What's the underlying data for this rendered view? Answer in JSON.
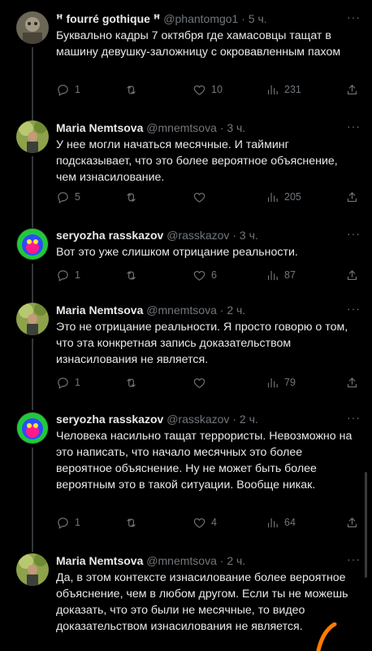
{
  "tweets": [
    {
      "name": "ꟸ fourré gothique ꟸ",
      "handle": "@phantomgo1",
      "time": "5 ч.",
      "text": "Буквально кадры 7 октября где хамасовцы тащат в машину девушку-заложницу с окровавленным пахом",
      "replies": "1",
      "retweets": "",
      "likes": "10",
      "views": "231"
    },
    {
      "name": "Maria Nemtsova",
      "handle": "@mnemtsova",
      "time": "3 ч.",
      "text": "У нее могли начаться месячные. И тайминг подсказывает, что это более вероятное объяснение, чем изнасилование.",
      "replies": "5",
      "retweets": "",
      "likes": "",
      "views": "205"
    },
    {
      "name": "seryozha rasskazov",
      "handle": "@rasskazov",
      "time": "3 ч.",
      "text": "Вот это уже слишком отрицание реальности.",
      "replies": "1",
      "retweets": "",
      "likes": "6",
      "views": "87"
    },
    {
      "name": "Maria Nemtsova",
      "handle": "@mnemtsova",
      "time": "2 ч.",
      "text": "Это не отрицание реальности. Я просто говорю о том, что эта конкретная запись доказательством изнасилования не является.",
      "replies": "1",
      "retweets": "",
      "likes": "",
      "views": "79"
    },
    {
      "name": "seryozha rasskazov",
      "handle": "@rasskazov",
      "time": "2 ч.",
      "text": "Человека насильно тащат террористы. Невозможно на это написать, что начало месячных это более вероятное объяснение. Ну не может быть более вероятным это в такой ситуации. Вообще никак.",
      "replies": "1",
      "retweets": "",
      "likes": "4",
      "views": "64"
    },
    {
      "name": "Maria Nemtsova",
      "handle": "@mnemtsova",
      "time": "2 ч.",
      "text": "Да, в этом контексте изнасилование более вероятное объяснение, чем в любом другом. Если ты не можешь доказать, что это были не месячные, то видео доказательством изнасилования не является."
    }
  ],
  "separator": "·",
  "more_glyph": "···",
  "colors": {
    "background": "#000000",
    "text": "#e7e9ea",
    "muted": "#71767b",
    "thread_line": "#333639",
    "scribble": "#ff7a00"
  },
  "icons": [
    "reply-icon",
    "retweet-icon",
    "like-icon",
    "views-icon",
    "share-icon",
    "more-icon"
  ]
}
